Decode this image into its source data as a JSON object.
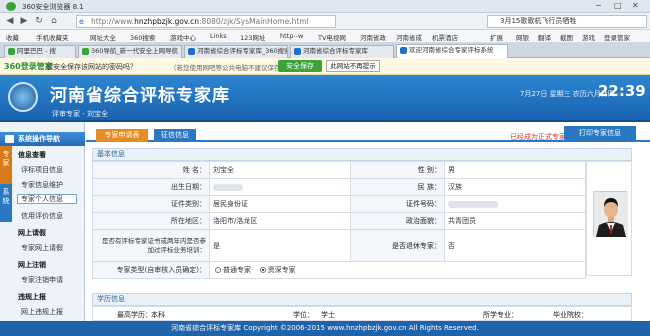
{
  "browser": {
    "title": "360安全浏览器 8.1",
    "url_prefix": "http://www.",
    "url_host": "hnzhpbzjk.gov.cn",
    "url_rest": ":8080/zjk/SysMainHome.html",
    "search_text": "3月15歌歌机飞行员牺牲",
    "bookmarks": [
      "收藏",
      "手机收藏夹",
      "网址大全",
      "360搜索",
      "游戏中心",
      "Links",
      "123网址",
      "http--w",
      "TV电视网",
      "河南省政",
      "河南省成",
      "机票酒店"
    ],
    "bookmark_extra": [
      "扩展",
      "网银",
      "翻译",
      "截图",
      "游戏",
      "登录管家"
    ],
    "tabs": [
      {
        "label": "阿里巴巴 - 搜"
      },
      {
        "label": "360导航_新一代安全上网导航"
      },
      {
        "label": "河南省综合评标专家库_360搜索"
      },
      {
        "label": "河南省综合评标专家库"
      },
      {
        "label": "欢迎河南省综合专家评标系统"
      }
    ]
  },
  "savebar": {
    "brand": "360登录管家",
    "question": "想安全保存该网站的密码吗？",
    "hint": "（若您使用网吧等公共电脑不建议保存）",
    "save_button": "安全保存",
    "never_button": "此网站不再提示"
  },
  "site": {
    "title": "河南省综合评标专家库",
    "user_line": "评审专家 - 刘宝全",
    "date_text": "7月27日 星期三 农历六月廿四",
    "clock": "22:39",
    "footer": "河南省综合评标专家库 Copyright ©2006-2015 www.hnzhpbzjk.gov.cn All Rights Reserved."
  },
  "sidebar": {
    "heading": "系统操作导航",
    "vtab_expert": "专家",
    "vtab_system": "系统",
    "groups": [
      {
        "title": "信息查看",
        "items": [
          "评标项目信息",
          "专家信息维护",
          "专家个人信息",
          "信用评价信息"
        ]
      },
      {
        "title": "网上请假",
        "items": [
          "专家网上请假"
        ]
      },
      {
        "title": "网上注销",
        "items": [
          "专家注销申请"
        ]
      },
      {
        "title": "违规上报",
        "items": [
          "网上违规上报"
        ]
      }
    ]
  },
  "content": {
    "tab_apply": "专家申请表",
    "tab_credit": "征信信息",
    "note": "已经成为正式专家",
    "print_button": "打印专家信息",
    "section_basic": "基本信息",
    "section_edu": "学历信息",
    "fields": {
      "name_label": "姓  名：",
      "name_value": "刘宝全",
      "gender_label": "性  别：",
      "gender_value": "男",
      "birth_label": "出生日期：",
      "ethnic_label": "民  族：",
      "ethnic_value": "汉族",
      "idtype_label": "证件类别：",
      "idtype_value": "居民身份证",
      "idno_label": "证件号码：",
      "region_label": "所在地区：",
      "region_value": "洛阳市/洛龙区",
      "politics_label": "政治面貌：",
      "politics_value": "共青团员",
      "evalcert_label": "是否有评标专家证书或两年内是否参加过评标业务培训：",
      "evalcert_value": "是",
      "retired_label": "是否退休专家：",
      "retired_value": "否",
      "type_label": "专家类型(自审核入员确定)：",
      "type_options": [
        "普通专家",
        "资深专家"
      ],
      "type_selected": 1
    },
    "edu_labels": [
      "最高学历：",
      "学位：",
      "所学专业：",
      "毕业院校："
    ],
    "edu_values": [
      "本科",
      "学士",
      "",
      ""
    ]
  }
}
